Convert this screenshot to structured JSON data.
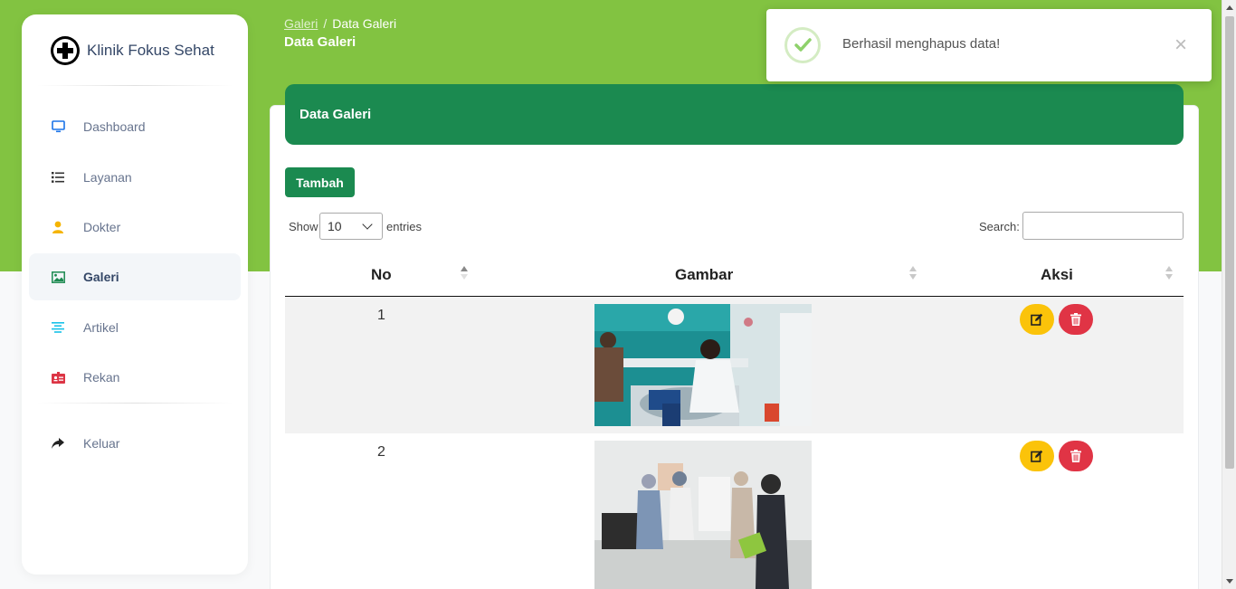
{
  "brand": {
    "name": "Klinik Fokus Sehat"
  },
  "sidebar": {
    "items": [
      {
        "label": "Dashboard",
        "icon": "monitor-icon"
      },
      {
        "label": "Layanan",
        "icon": "list-icon"
      },
      {
        "label": "Dokter",
        "icon": "user-icon"
      },
      {
        "label": "Galeri",
        "icon": "image-icon",
        "active": true
      },
      {
        "label": "Artikel",
        "icon": "align-center-icon"
      },
      {
        "label": "Rekan",
        "icon": "id-card-icon"
      },
      {
        "label": "Keluar",
        "icon": "share-arrow-icon"
      }
    ]
  },
  "breadcrumb": {
    "parent": "Galeri",
    "separator": "/",
    "current": "Data Galeri"
  },
  "page": {
    "title": "Data Galeri"
  },
  "card": {
    "header": "Data Galeri"
  },
  "toolbar": {
    "add_label": "Tambah",
    "show_label": "Show",
    "entries_value": "10",
    "entries_label": "entries",
    "search_label": "Search:",
    "search_value": ""
  },
  "table": {
    "headers": [
      "No",
      "Gambar",
      "Aksi"
    ],
    "rows": [
      {
        "no": "1"
      },
      {
        "no": "2"
      }
    ]
  },
  "toast": {
    "message": "Berhasil menghapus data!",
    "close": "×"
  },
  "colors": {
    "accent": "#82c341",
    "primary": "#1b8a50",
    "warning": "#fbc30a",
    "danger": "#e03445"
  }
}
